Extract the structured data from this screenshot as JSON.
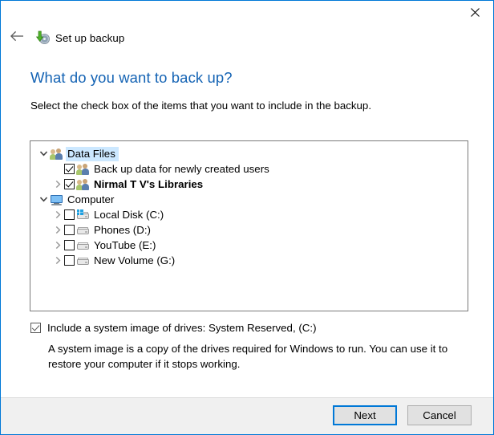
{
  "window": {
    "border_color": "#0078d7",
    "close_icon": "close-icon"
  },
  "nav": {
    "back_icon": "back-arrow-icon",
    "wizard_icon": "backup-disc-icon",
    "title": "Set up backup"
  },
  "page": {
    "title": "What do you want to back up?",
    "subtitle": "Select the check box of the items that you want to include in the backup.",
    "title_color": "#1463b4"
  },
  "tree": {
    "nodes": [
      {
        "label": "Data Files",
        "level": 0,
        "icon": "users-icon",
        "expander": "chevron-down-icon",
        "has_checkbox": false,
        "checked": false,
        "selected": true,
        "bold": false
      },
      {
        "label": "Back up data for newly created users",
        "level": 1,
        "icon": "users-icon",
        "expander": "none",
        "has_checkbox": true,
        "checked": true,
        "selected": false,
        "bold": false
      },
      {
        "label": "Nirmal T V's Libraries",
        "level": 1,
        "icon": "users-icon",
        "expander": "chevron-right-icon",
        "has_checkbox": true,
        "checked": true,
        "selected": false,
        "bold": true
      },
      {
        "label": "Computer",
        "level": 0,
        "icon": "monitor-icon",
        "expander": "chevron-down-icon",
        "has_checkbox": false,
        "checked": false,
        "selected": false,
        "bold": false
      },
      {
        "label": "Local Disk (C:)",
        "level": 1,
        "icon": "system-drive-icon",
        "expander": "chevron-right-icon",
        "has_checkbox": true,
        "checked": false,
        "selected": false,
        "bold": false
      },
      {
        "label": "Phones (D:)",
        "level": 1,
        "icon": "drive-icon",
        "expander": "chevron-right-icon",
        "has_checkbox": true,
        "checked": false,
        "selected": false,
        "bold": false
      },
      {
        "label": "YouTube (E:)",
        "level": 1,
        "icon": "drive-icon",
        "expander": "chevron-right-icon",
        "has_checkbox": true,
        "checked": false,
        "selected": false,
        "bold": false
      },
      {
        "label": "New Volume (G:)",
        "level": 1,
        "icon": "drive-icon",
        "expander": "chevron-right-icon",
        "has_checkbox": true,
        "checked": false,
        "selected": false,
        "bold": false
      }
    ]
  },
  "system_image": {
    "checked": true,
    "label": "Include a system image of drives: System Reserved, (C:)",
    "description": "A system image is a copy of the drives required for Windows to run. You can use it to restore your computer if it stops working."
  },
  "footer": {
    "next_label": "Next",
    "cancel_label": "Cancel",
    "default_button": "Next"
  }
}
